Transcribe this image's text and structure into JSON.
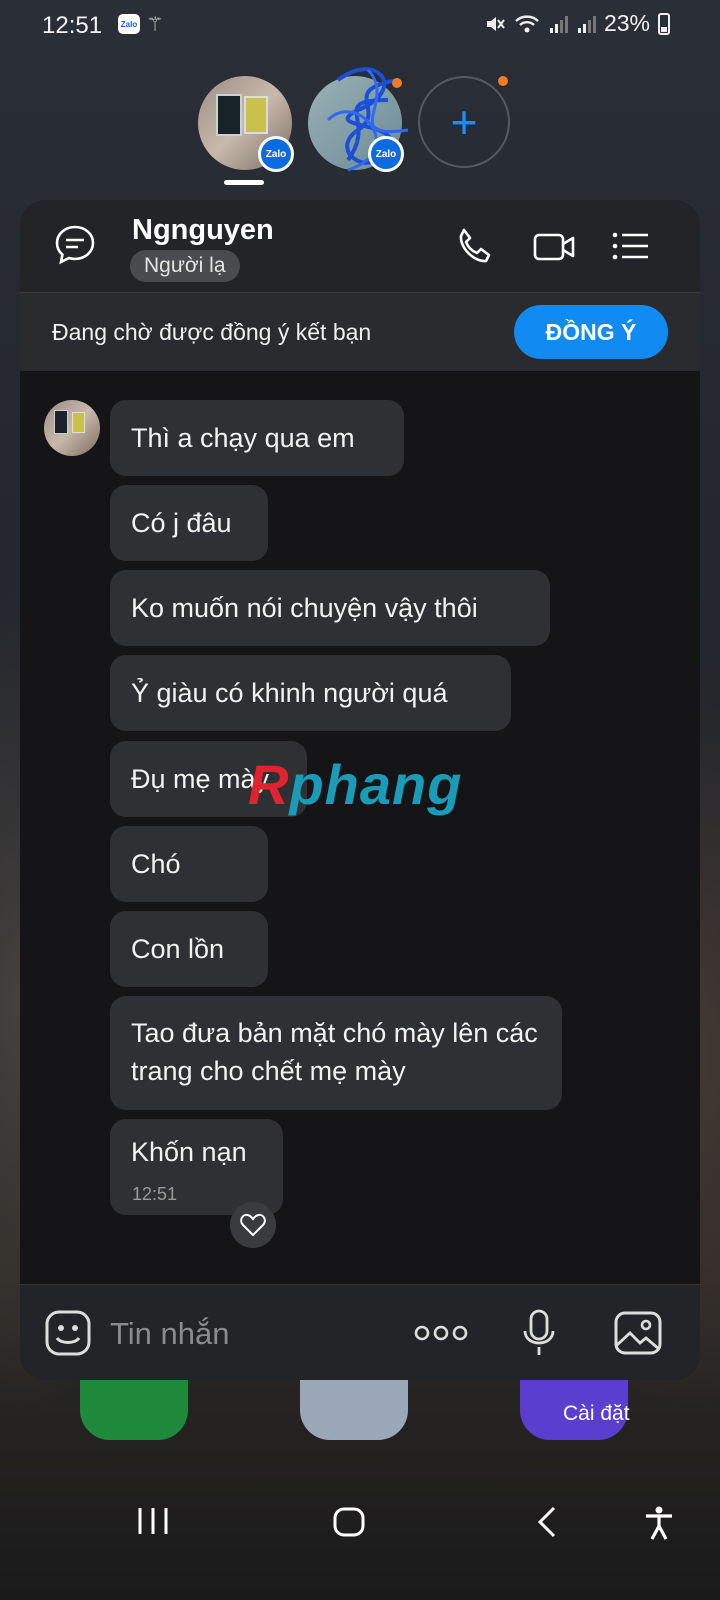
{
  "status_bar": {
    "time": "12:51",
    "battery": "23%",
    "notif_app": "Zalo"
  },
  "chat_heads": {
    "badge": "Zalo",
    "add_label": "+"
  },
  "header": {
    "name": "Ngnguyen",
    "tag": "Người lạ"
  },
  "pending": {
    "text": "Đang chờ được đồng ý kết bạn",
    "accept_label": "ĐỒNG Ý"
  },
  "messages": [
    {
      "text": "Thì a chạy qua em"
    },
    {
      "text": "Có j đâu"
    },
    {
      "text": "Ko muốn nói chuyện vậy thôi"
    },
    {
      "text": "Ỷ giàu có khinh người quá"
    },
    {
      "text": "Đụ mẹ mày"
    },
    {
      "text": "Chó"
    },
    {
      "text": "Con lồn"
    },
    {
      "text": "Tao đưa bản mặt chó mày lên các trang cho chết mẹ mày"
    },
    {
      "text": "Khốn nạn",
      "time": "12:51"
    }
  ],
  "watermark": {
    "r": "R",
    "rest": "phang"
  },
  "input": {
    "placeholder": "Tin nhắn"
  },
  "home": {
    "settings_label": "Cài đặt"
  },
  "colors": {
    "accent": "#118bf1",
    "bubble": "#2f3033",
    "panel": "#151517",
    "notify_dot": "#f07b28"
  }
}
